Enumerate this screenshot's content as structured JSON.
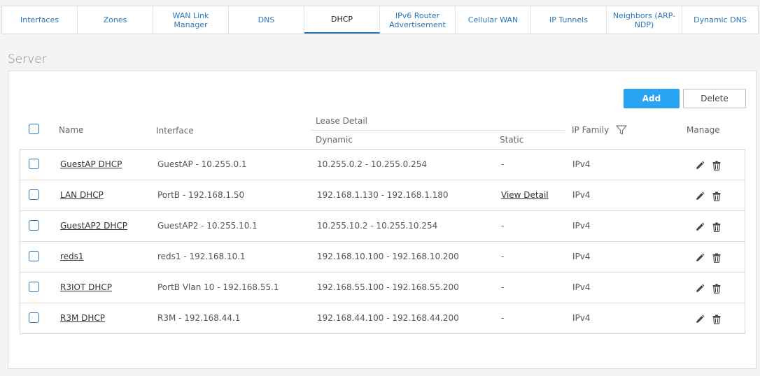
{
  "tabs": [
    {
      "label": "Interfaces",
      "active": false
    },
    {
      "label": "Zones",
      "active": false
    },
    {
      "label": "WAN Link Manager",
      "active": false
    },
    {
      "label": "DNS",
      "active": false
    },
    {
      "label": "DHCP",
      "active": true
    },
    {
      "label": "IPv6 Router Advertisement",
      "active": false
    },
    {
      "label": "Cellular WAN",
      "active": false
    },
    {
      "label": "IP Tunnels",
      "active": false
    },
    {
      "label": "Neighbors (ARP-NDP)",
      "active": false
    },
    {
      "label": "Dynamic DNS",
      "active": false
    }
  ],
  "section_title": "Server",
  "toolbar": {
    "add_label": "Add",
    "delete_label": "Delete"
  },
  "table": {
    "headers": {
      "name": "Name",
      "interface": "Interface",
      "lease_detail": "Lease Detail",
      "dynamic": "Dynamic",
      "static": "Static",
      "ip_family": "IP Family",
      "manage": "Manage"
    },
    "rows": [
      {
        "name": "GuestAP DHCP",
        "interface": "GuestAP - 10.255.0.1",
        "dynamic": "10.255.0.2 - 10.255.0.254",
        "static": "-",
        "static_link": false,
        "ip_family": "IPv4"
      },
      {
        "name": "LAN DHCP",
        "interface": "PortB - 192.168.1.50",
        "dynamic": "192.168.1.130 - 192.168.1.180",
        "static": "View Detail",
        "static_link": true,
        "ip_family": "IPv4"
      },
      {
        "name": "GuestAP2 DHCP",
        "interface": "GuestAP2 - 10.255.10.1",
        "dynamic": "10.255.10.2 - 10.255.10.254",
        "static": "-",
        "static_link": false,
        "ip_family": "IPv4"
      },
      {
        "name": "reds1",
        "interface": "reds1 - 192.168.10.1",
        "dynamic": "192.168.10.100 - 192.168.10.200",
        "static": "-",
        "static_link": false,
        "ip_family": "IPv4"
      },
      {
        "name": "R3IOT DHCP",
        "interface": "PortB Vlan 10 - 192.168.55.1",
        "dynamic": "192.168.55.100 - 192.168.55.200",
        "static": "-",
        "static_link": false,
        "ip_family": "IPv4"
      },
      {
        "name": "R3M DHCP",
        "interface": "R3M - 192.168.44.1",
        "dynamic": "192.168.44.100 - 192.168.44.200",
        "static": "-",
        "static_link": false,
        "ip_family": "IPv4"
      }
    ]
  },
  "icons": {
    "filter": "filter-icon",
    "edit": "pencil-icon",
    "delete": "trash-icon"
  },
  "colors": {
    "accent": "#2aa3f2",
    "link": "#2a76b9"
  }
}
